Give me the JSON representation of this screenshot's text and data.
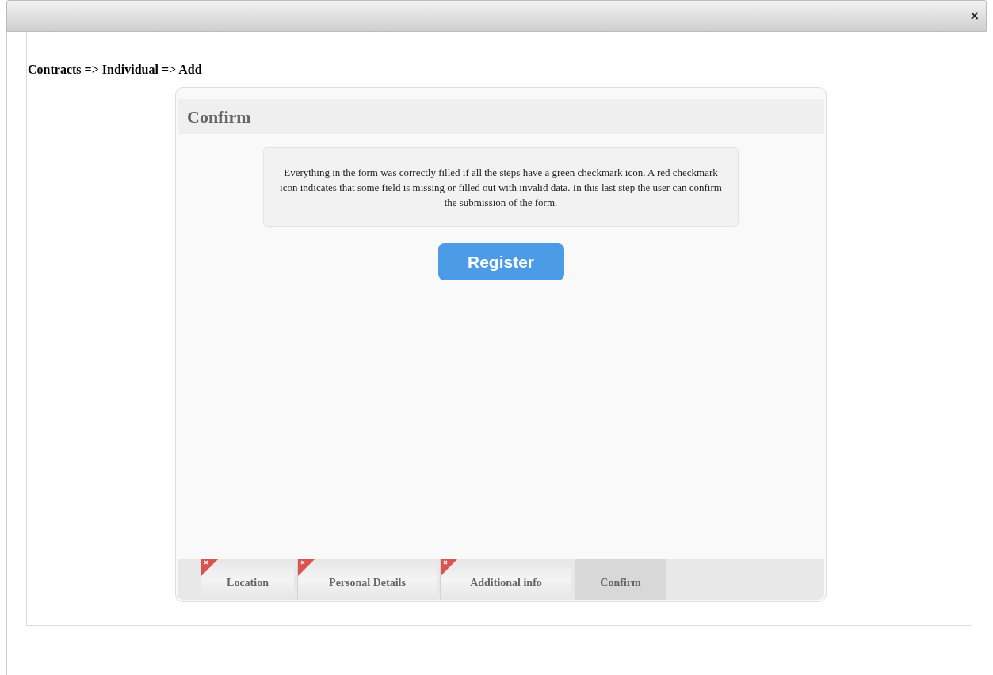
{
  "dialog": {
    "close": "×"
  },
  "breadcrumb": "Contracts => Individual => Add",
  "panel": {
    "title": "Confirm",
    "info": "Everything in the form was correctly filled if all the steps have a green checkmark icon. A red checkmark icon indicates that some field is missing or filled out with invalid data. In this last step the user can confirm the submission of the form.",
    "button": "Register"
  },
  "steps": [
    {
      "label": "Location",
      "selected": false,
      "invalid": true
    },
    {
      "label": "Personal Details",
      "selected": false,
      "invalid": true
    },
    {
      "label": "Additional info",
      "selected": false,
      "invalid": true
    },
    {
      "label": "Confirm",
      "selected": true,
      "invalid": false
    }
  ]
}
